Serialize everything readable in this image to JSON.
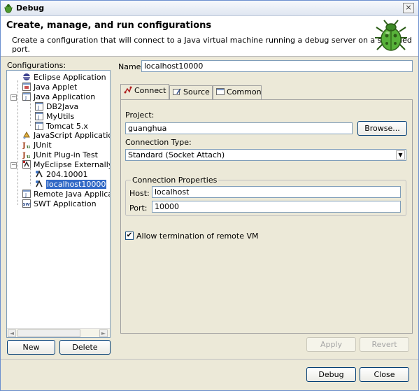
{
  "window": {
    "title": "Debug",
    "close_glyph": "×"
  },
  "header": {
    "title": "Create, manage, and run configurations",
    "description": "Create a configuration that will connect to a Java virtual machine running a debug server on a specified port."
  },
  "left": {
    "label": "Configurations:",
    "tree": [
      "Eclipse Application",
      "Java Applet",
      "Java Application",
      "DB2Java",
      "MyUtils",
      "Tomcat 5.x",
      "JavaScript Application",
      "JUnit",
      "JUnit Plug-in Test",
      "MyEclipse Externally Lau",
      "204.10001",
      "localhost10000",
      "Remote Java Application",
      "SWT Application"
    ],
    "new_label": "New",
    "delete_label": "Delete"
  },
  "name": {
    "label": "Name:",
    "value": "localhost10000"
  },
  "tabs": [
    "Connect",
    "Source",
    "Common"
  ],
  "connect": {
    "project_label": "Project:",
    "project_value": "guanghua",
    "browse_label": "Browse...",
    "conn_type_label": "Connection Type:",
    "conn_type_value": "Standard (Socket Attach)",
    "conn_props_label": "Connection Properties",
    "host_label": "Host:",
    "host_value": "localhost",
    "port_label": "Port:",
    "port_value": "10000",
    "allow_term_label": "Allow termination of remote VM",
    "allow_term_checked": true
  },
  "actions": {
    "apply": "Apply",
    "revert": "Revert",
    "debug": "Debug",
    "close": "Close"
  },
  "colors": {
    "selection": "#3169c6",
    "dialog_bg": "#ece9d8",
    "bug_green": "#58b23a"
  }
}
